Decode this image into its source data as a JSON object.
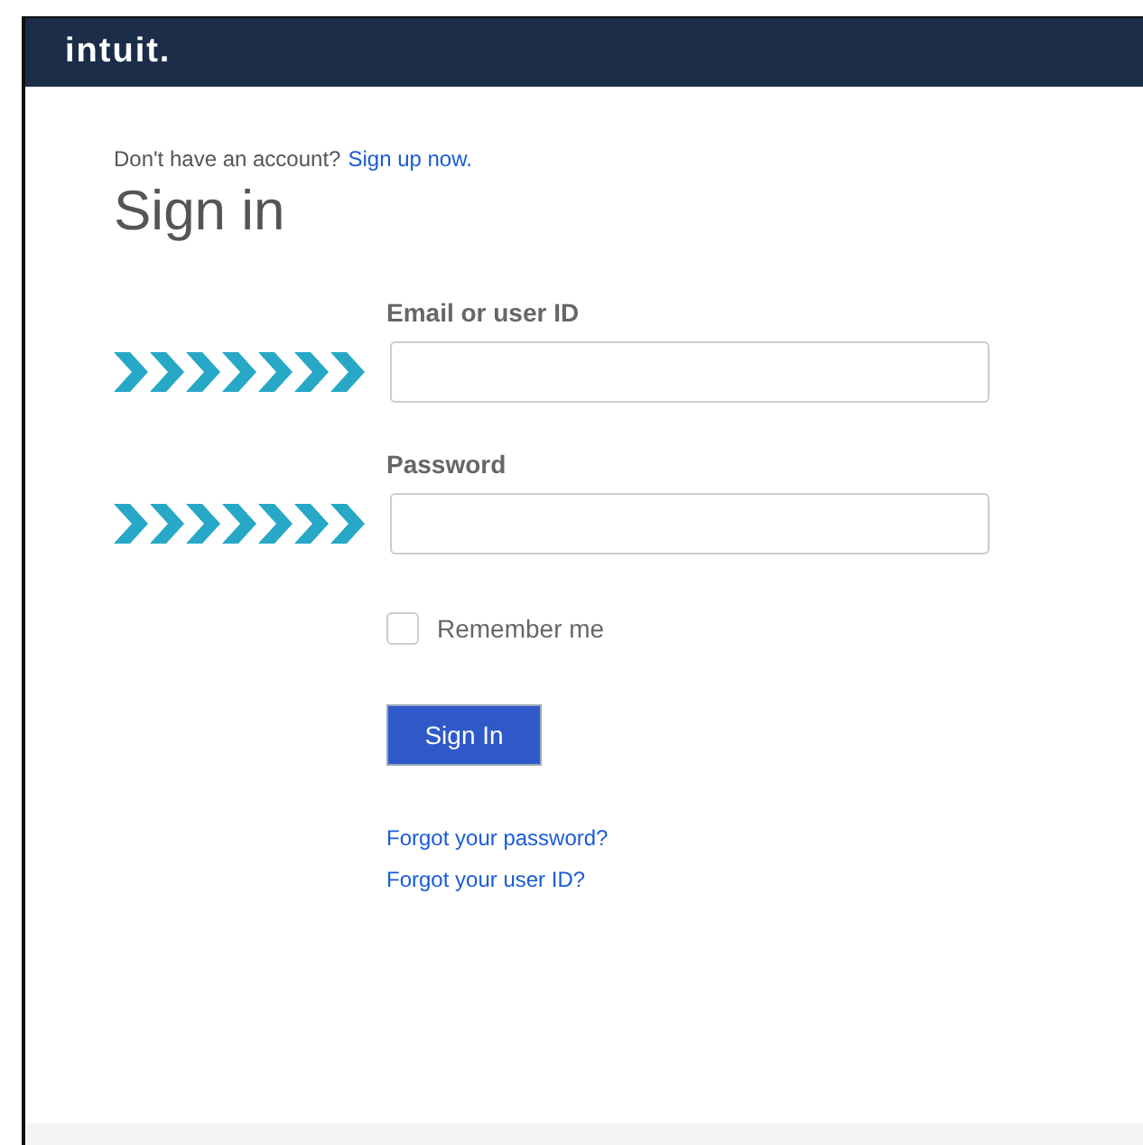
{
  "header": {
    "logo": "intuit."
  },
  "signup_prompt": {
    "text": "Don't have an account?",
    "link": "Sign up now."
  },
  "title": "Sign in",
  "fields": [
    {
      "label": "Email or user ID"
    },
    {
      "label": "Password"
    }
  ],
  "remember_me": {
    "label": "Remember me",
    "checked": false
  },
  "submit": "Sign In",
  "links": [
    "Forgot your password?",
    "Forgot your user ID?"
  ]
}
